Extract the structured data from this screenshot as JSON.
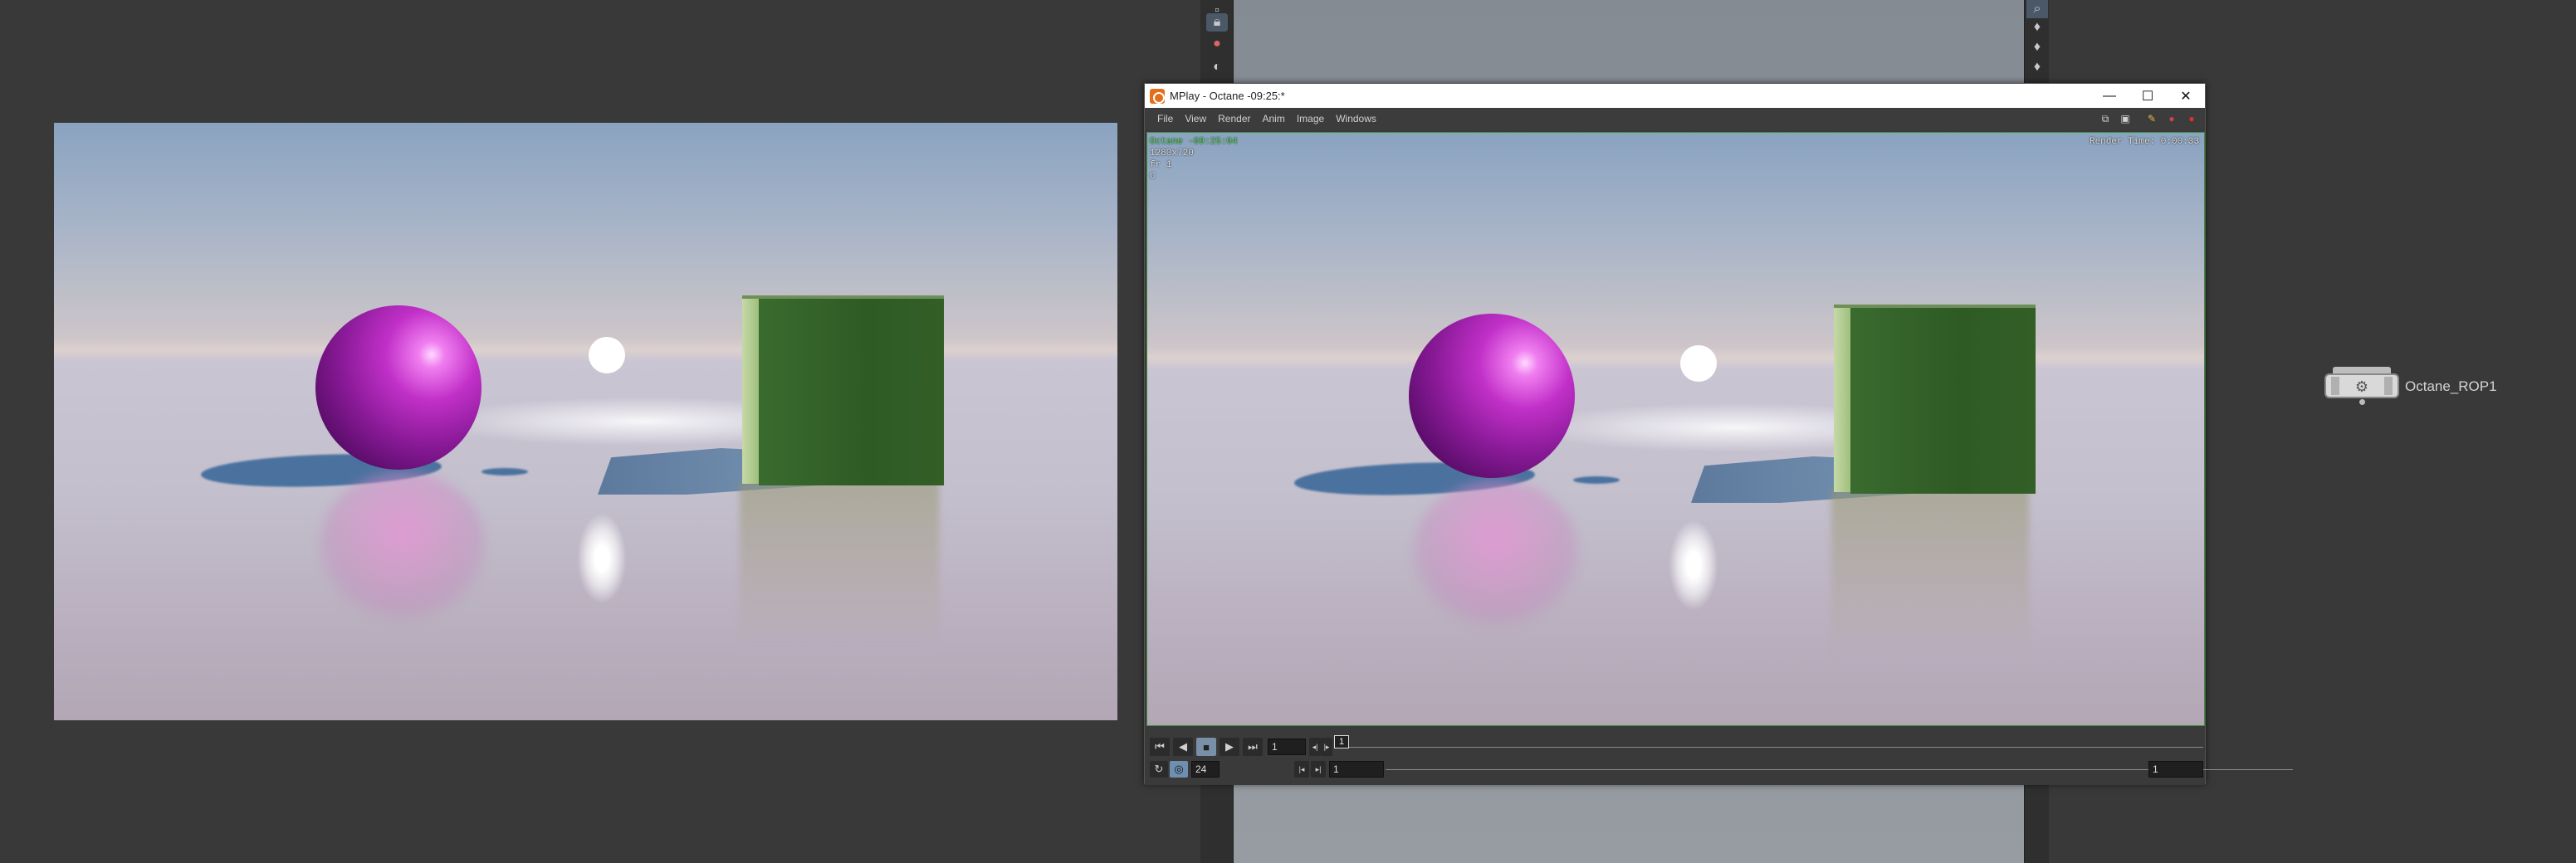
{
  "mplay": {
    "title": "MPlay - Octane -09:25:*",
    "window_controls": {
      "minimize": "—",
      "maximize": "☐",
      "close": "✕"
    },
    "menu": [
      "File",
      "View",
      "Render",
      "Anim",
      "Image",
      "Windows"
    ],
    "overlay": {
      "label": "Octane -09:25:04",
      "resolution": "1280x720",
      "frame": "fr 1",
      "channel": "C",
      "render_time": "Render Time: 0:00:33"
    },
    "timeline": {
      "current_frame": "1",
      "marker": "1",
      "fps": "24",
      "start_frame": "1",
      "end_frame": "1"
    }
  },
  "node": {
    "label": "Octane_ROP1"
  },
  "colors": {
    "viewer_border": "#3b8f3b",
    "overlay_label": "#4fd24f",
    "node_body": "#d9d9d9"
  }
}
